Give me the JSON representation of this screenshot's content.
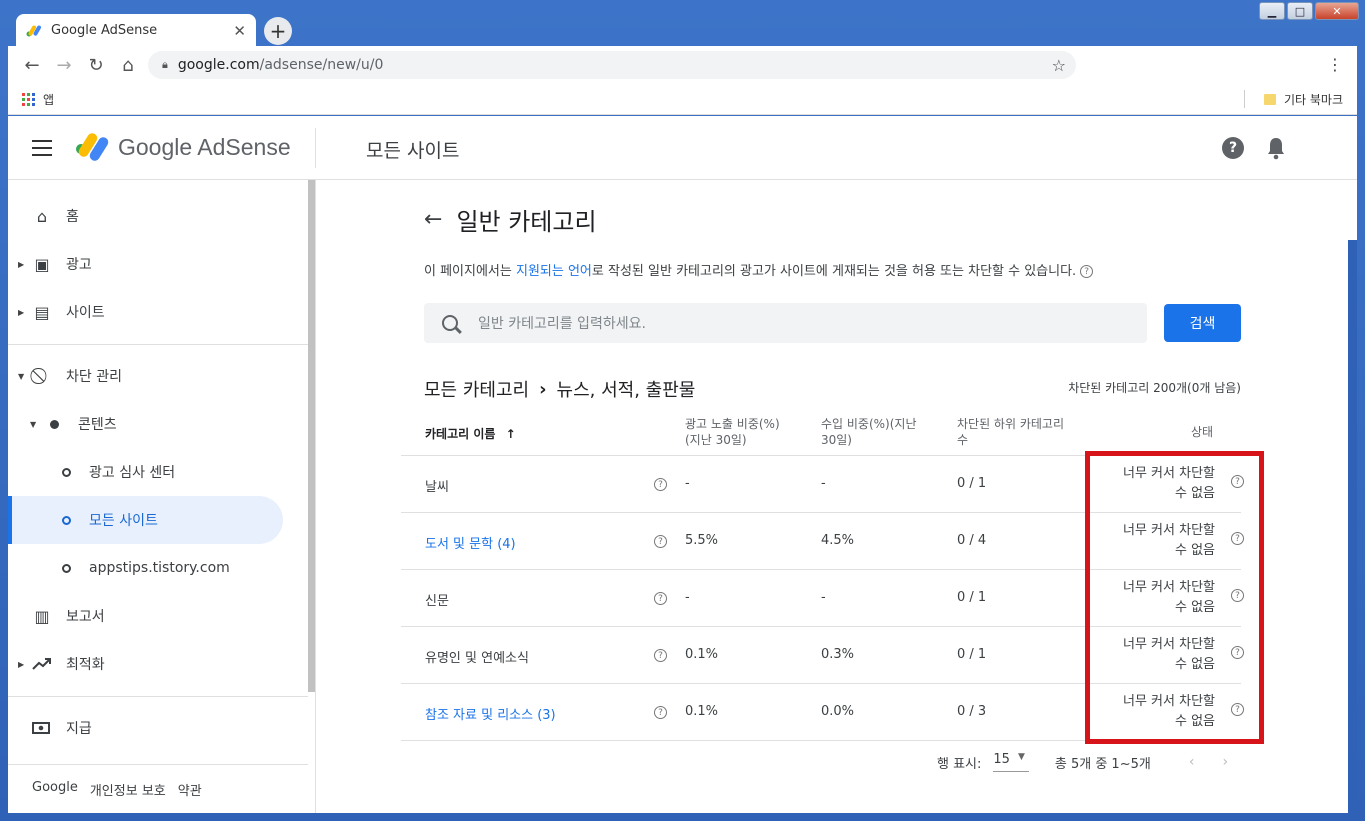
{
  "browser": {
    "tab_title": "Google AdSense",
    "url_host": "google.com",
    "url_path": "/adsense/new/u/0",
    "bookmark_apps": "앱",
    "bookmark_other": "기타 북마크"
  },
  "appbar": {
    "brand": "Google AdSense",
    "title": "모든 사이트"
  },
  "sidebar": {
    "items": [
      {
        "label": "홈",
        "icon": "home-icon"
      },
      {
        "label": "광고",
        "icon": "ads-icon"
      },
      {
        "label": "사이트",
        "icon": "sites-icon"
      },
      {
        "label": "차단 관리",
        "icon": "block-icon"
      },
      {
        "label": "콘텐츠",
        "icon": "dot-icon"
      },
      {
        "label": "광고 심사 센터",
        "icon": "circle-icon"
      },
      {
        "label": "모든 사이트",
        "icon": "circle-icon"
      },
      {
        "label": "appstips.tistory.com",
        "icon": "circle-icon"
      },
      {
        "label": "보고서",
        "icon": "reports-icon"
      },
      {
        "label": "최적화",
        "icon": "trend-icon"
      },
      {
        "label": "지급",
        "icon": "payments-icon"
      }
    ],
    "footer": [
      "Google",
      "개인정보 보호",
      "약관"
    ]
  },
  "main": {
    "title": "일반 카테고리",
    "desc_pre": "이 페이지에서는 ",
    "desc_link": "지원되는 언어",
    "desc_post": "로 작성된 일반 카테고리의 광고가 사이트에 게재되는 것을 허용 또는 차단할 수 있습니다.",
    "search_placeholder": "일반 카테고리를 입력하세요.",
    "search_button": "검색",
    "breadcrumb_root": "모든 카테고리",
    "breadcrumb_current": "뉴스, 서적, 출판물",
    "blocked_count": "차단된 카테고리 200개(0개 남음)",
    "columns": {
      "name": "카테고리 이름",
      "impr": "광고 노출 비중(%)",
      "impr2": "(지난 30일)",
      "rev": "수입 비중(%)(지난",
      "rev2": "30일)",
      "blocked": "차단된 하위 카테고리",
      "blocked2": "수",
      "status": "상태"
    },
    "rows": [
      {
        "name": "날씨",
        "impr": "-",
        "rev": "-",
        "blocked": "0 / 1",
        "status1": "너무 커서 차단할",
        "status2": "수 없음"
      },
      {
        "name": "도서 및 문학 (4)",
        "impr": "5.5%",
        "rev": "4.5%",
        "blocked": "0 / 4",
        "status1": "너무 커서 차단할",
        "status2": "수 없음"
      },
      {
        "name": "신문",
        "impr": "-",
        "rev": "-",
        "blocked": "0 / 1",
        "status1": "너무 커서 차단할",
        "status2": "수 없음"
      },
      {
        "name": "유명인 및 연예소식",
        "impr": "0.1%",
        "rev": "0.3%",
        "blocked": "0 / 1",
        "status1": "너무 커서 차단할",
        "status2": "수 없음"
      },
      {
        "name": "참조 자료 및 리소스 (3)",
        "impr": "0.1%",
        "rev": "0.0%",
        "blocked": "0 / 3",
        "status1": "너무 커서 차단할",
        "status2": "수 없음"
      }
    ],
    "pager": {
      "rows_label": "행 표시:",
      "rows_value": "15",
      "range": "총 5개 중 1~5개"
    }
  },
  "colors": {
    "accent": "#1a73e8",
    "highlight": "#d7141a"
  }
}
